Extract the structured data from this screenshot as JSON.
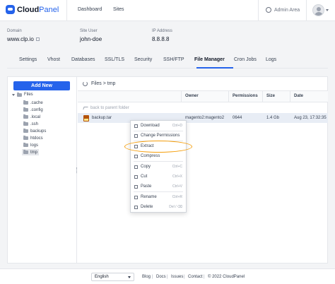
{
  "header": {
    "brand_main": "Cloud",
    "brand_accent": "Panel",
    "nav": [
      "Dashboard",
      "Sites"
    ],
    "admin_area": "Admin Area"
  },
  "site": {
    "domain_label": "Domain",
    "domain_value": "www.clp.io",
    "user_label": "Site User",
    "user_value": "john-doe",
    "ip_label": "IP Address",
    "ip_value": "8.8.8.8"
  },
  "tabs": [
    "Settings",
    "Vhost",
    "Databases",
    "SSL/TLS",
    "Security",
    "SSH/FTP",
    "File Manager",
    "Cron Jobs",
    "Logs"
  ],
  "active_tab": "File Manager",
  "tree": {
    "add_new": "Add New",
    "root": "Files",
    "items": [
      ".cache",
      ".config",
      ".local",
      ".ssh",
      "backups",
      "htdocs",
      "logs",
      "tmp"
    ],
    "selected": "tmp"
  },
  "path": "Files > tmp",
  "table": {
    "columns": [
      "Owner",
      "Permissions",
      "Size",
      "Date"
    ],
    "back_label": "back to parent folder",
    "rows": [
      {
        "name": "backup.tar",
        "owner": "magento2:magento2",
        "permissions": "0644",
        "size": "1.4 Gb",
        "date": "Aug 23, 17:32:35"
      }
    ]
  },
  "context_menu": [
    {
      "label": "Download",
      "key": "Ctrl+D"
    },
    {
      "label": "Change Permissions",
      "key": ""
    },
    {
      "label": "Extract",
      "key": ""
    },
    {
      "label": "Compress",
      "key": ""
    },
    {
      "label": "Copy",
      "key": "Ctrl+C"
    },
    {
      "label": "Cut",
      "key": "Ctrl+X"
    },
    {
      "label": "Paste",
      "key": "Ctrl+V"
    },
    {
      "label": "Rename",
      "key": "Ctrl+R"
    },
    {
      "label": "Delete",
      "key": "Del / ⌫"
    }
  ],
  "footer": {
    "language": "English",
    "links": [
      "Blog",
      "Docs",
      "Issues",
      "Contact"
    ],
    "copyright": "© 2022  CloudPanel"
  },
  "colors": {
    "accent": "#2563eb",
    "highlight": "#f59e0b"
  }
}
